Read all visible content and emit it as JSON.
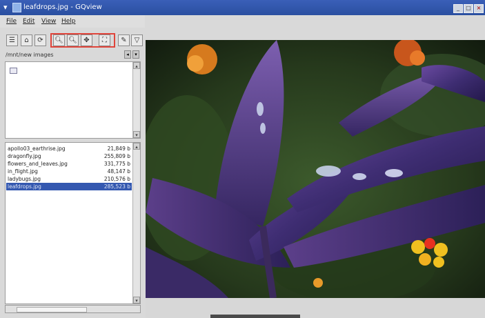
{
  "window": {
    "title": "leafdrops.jpg - GQview"
  },
  "menubar": [
    {
      "label": "File"
    },
    {
      "label": "Edit"
    },
    {
      "label": "View"
    },
    {
      "label": "Help"
    }
  ],
  "toolbar_tools": [
    "view-mode-icon",
    "home-icon",
    "reload-icon",
    "zoom-in-icon",
    "zoom-out-icon",
    "zoom-fit-icon",
    "zoom-original-icon",
    "config-icon",
    "filter-icon"
  ],
  "directory": {
    "label": "/mnt/new images"
  },
  "files": [
    {
      "name": "apollo03_earthrise.jpg",
      "size": "21,849 b"
    },
    {
      "name": "dragonfly.jpg",
      "size": "255,809 b"
    },
    {
      "name": "flowers_and_leaves.jpg",
      "size": "331,775 b"
    },
    {
      "name": "in_flight.jpg",
      "size": "48,147 b"
    },
    {
      "name": "ladybugs.jpg",
      "size": "210,576 b"
    },
    {
      "name": "leafdrops.jpg",
      "size": "285,523 b",
      "selected": true
    }
  ],
  "colors": {
    "titlebar": "#2a4fa0",
    "selection": "#3458b0",
    "highlight_box": "#e0443a"
  }
}
